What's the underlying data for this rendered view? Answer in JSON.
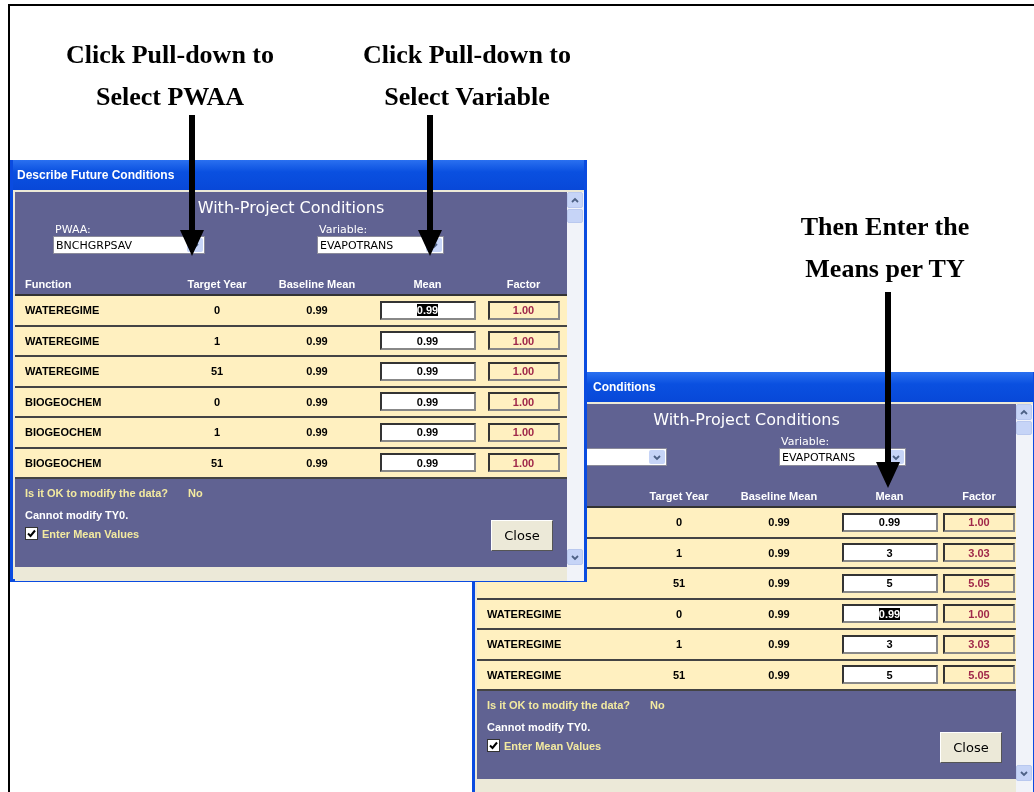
{
  "callouts": [
    {
      "text": "Click Pull-down to\nSelect PWAA"
    },
    {
      "text": "Click Pull-down to\nSelect Variable"
    },
    {
      "text": "Then Enter the\nMeans per TY"
    }
  ],
  "windows": [
    {
      "title": "Describe Future Conditions",
      "heading": "With-Project Conditions",
      "pwaa": {
        "label": "PWAA:",
        "value": "BNCHGRPSAV"
      },
      "variable": {
        "label": "Variable:",
        "value": "EVAPOTRANS"
      },
      "headers": {
        "function": "Function",
        "target_year": "Target Year",
        "baseline_mean": "Baseline Mean",
        "mean": "Mean",
        "factor": "Factor"
      },
      "rows": [
        {
          "function": "WATEREGIME",
          "target_year": "0",
          "baseline_mean": "0.99",
          "mean": "0.99",
          "mean_selected": true,
          "factor": "1.00"
        },
        {
          "function": "WATEREGIME",
          "target_year": "1",
          "baseline_mean": "0.99",
          "mean": "0.99",
          "mean_selected": false,
          "factor": "1.00"
        },
        {
          "function": "WATEREGIME",
          "target_year": "51",
          "baseline_mean": "0.99",
          "mean": "0.99",
          "mean_selected": false,
          "factor": "1.00"
        },
        {
          "function": "BIOGEOCHEM",
          "target_year": "0",
          "baseline_mean": "0.99",
          "mean": "0.99",
          "mean_selected": false,
          "factor": "1.00"
        },
        {
          "function": "BIOGEOCHEM",
          "target_year": "1",
          "baseline_mean": "0.99",
          "mean": "0.99",
          "mean_selected": false,
          "factor": "1.00"
        },
        {
          "function": "BIOGEOCHEM",
          "target_year": "51",
          "baseline_mean": "0.99",
          "mean": "0.99",
          "mean_selected": false,
          "factor": "1.00"
        }
      ],
      "modify_question": "Is it OK to modify the data?",
      "modify_answer": "No",
      "note": "Cannot modify TY0.",
      "checkbox": {
        "label": "Enter Mean Values",
        "checked": true
      },
      "close_button": "Close"
    },
    {
      "title": "Conditions",
      "heading": "With-Project Conditions",
      "variable": {
        "label": "Variable:",
        "value": "EVAPOTRANS"
      },
      "headers": {
        "target_year": "Target Year",
        "baseline_mean": "Baseline Mean",
        "mean": "Mean",
        "factor": "Factor"
      },
      "rows": [
        {
          "target_year": "0",
          "baseline_mean": "0.99",
          "mean": "0.99",
          "mean_selected": false,
          "factor": "1.00"
        },
        {
          "target_year": "1",
          "baseline_mean": "0.99",
          "mean": "3",
          "mean_selected": false,
          "factor": "3.03"
        },
        {
          "target_year": "51",
          "baseline_mean": "0.99",
          "mean": "5",
          "mean_selected": false,
          "factor": "5.05"
        },
        {
          "function": "WATEREGIME",
          "target_year": "0",
          "baseline_mean": "0.99",
          "mean": "0.99",
          "mean_selected": true,
          "factor": "1.00"
        },
        {
          "function": "WATEREGIME",
          "target_year": "1",
          "baseline_mean": "0.99",
          "mean": "3",
          "mean_selected": false,
          "factor": "3.03"
        },
        {
          "function": "WATEREGIME",
          "target_year": "51",
          "baseline_mean": "0.99",
          "mean": "5",
          "mean_selected": false,
          "factor": "5.05"
        }
      ],
      "modify_question": "Is it OK to modify the data?",
      "modify_answer": "No",
      "note": "Cannot modify TY0.",
      "checkbox": {
        "label": "Enter Mean Values",
        "checked": true
      },
      "close_button": "Close"
    }
  ]
}
